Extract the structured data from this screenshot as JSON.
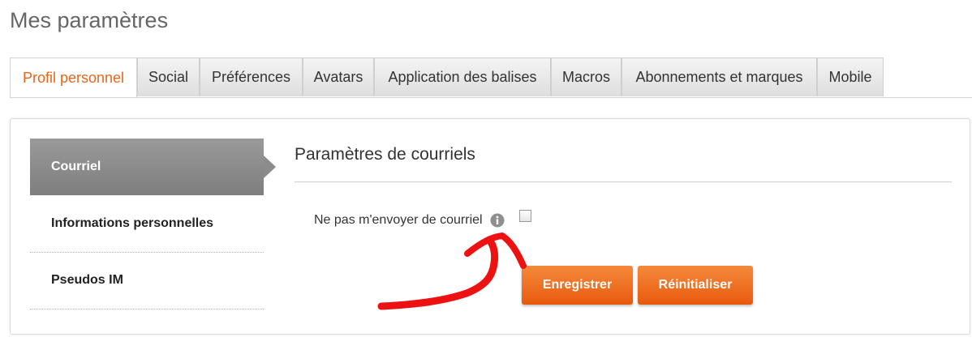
{
  "page": {
    "title": "Mes paramètres"
  },
  "tabs": [
    {
      "label": "Profil personnel",
      "active": true
    },
    {
      "label": "Social"
    },
    {
      "label": "Préférences"
    },
    {
      "label": "Avatars"
    },
    {
      "label": "Application des balises"
    },
    {
      "label": "Macros"
    },
    {
      "label": "Abonnements et marques"
    },
    {
      "label": "Mobile"
    }
  ],
  "sidebar": {
    "items": [
      {
        "label": "Courriel",
        "active": true
      },
      {
        "label": "Informations personnelles"
      },
      {
        "label": "Pseudos IM"
      }
    ]
  },
  "main": {
    "section_title": "Paramètres de courriels",
    "field_label": "Ne pas m'envoyer de courriel",
    "field_checked": false,
    "info_icon": "info-icon",
    "save_label": "Enregistrer",
    "reset_label": "Réinitialiser"
  },
  "colors": {
    "accent": "#e8661a",
    "button": "#f07024",
    "annotation": "#ee1111"
  }
}
